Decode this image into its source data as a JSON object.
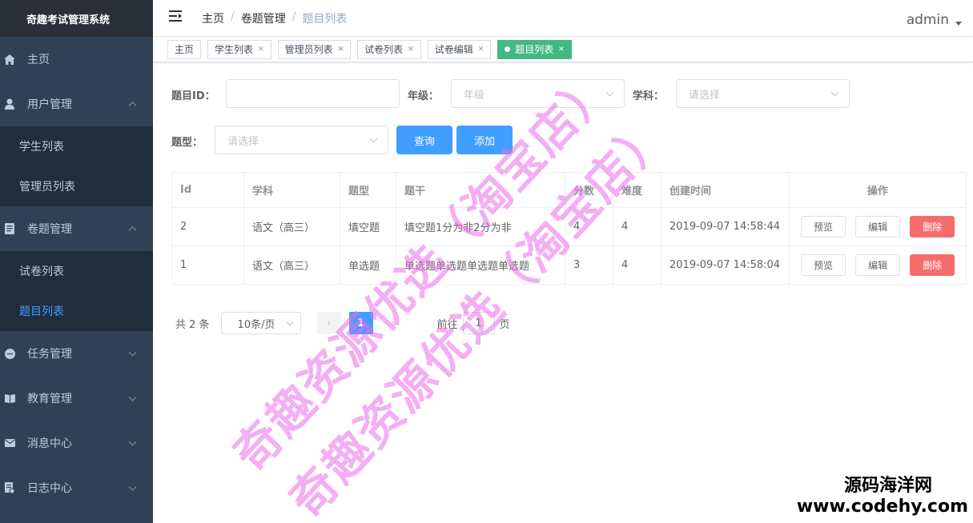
{
  "sidebar": {
    "logo": "奇趣考试管理系统",
    "items": [
      {
        "label": "主页",
        "icon": "home-icon"
      },
      {
        "label": "用户管理",
        "icon": "user-icon",
        "expanded": true,
        "children": [
          "学生列表",
          "管理员列表"
        ]
      },
      {
        "label": "卷题管理",
        "icon": "paper-icon",
        "expanded": true,
        "children": [
          "试卷列表",
          "题目列表"
        ]
      },
      {
        "label": "任务管理",
        "icon": "task-icon"
      },
      {
        "label": "教育管理",
        "icon": "book-icon"
      },
      {
        "label": "消息中心",
        "icon": "mail-icon"
      },
      {
        "label": "日志中心",
        "icon": "log-icon"
      }
    ],
    "active_child": "题目列表"
  },
  "header": {
    "breadcrumb": [
      "主页",
      "卷题管理",
      "题目列表"
    ],
    "user": "admin"
  },
  "tags": [
    {
      "label": "主页",
      "closable": false
    },
    {
      "label": "学生列表",
      "closable": true
    },
    {
      "label": "管理员列表",
      "closable": true
    },
    {
      "label": "试卷列表",
      "closable": true
    },
    {
      "label": "试卷编辑",
      "closable": true
    },
    {
      "label": "题目列表",
      "closable": true,
      "active": true
    }
  ],
  "filters": {
    "id_label": "题目ID：",
    "grade_label": "年级：",
    "grade_placeholder": "年级",
    "subject_label": "学科：",
    "subject_placeholder": "请选择",
    "type_label": "题型：",
    "type_placeholder": "请选择",
    "query_button": "查询",
    "add_button": "添加"
  },
  "table": {
    "columns": [
      "Id",
      "学科",
      "题型",
      "题干",
      "分数",
      "难度",
      "创建时间",
      "操作"
    ],
    "rows": [
      {
        "id": "2",
        "subject": "语文（高三）",
        "type": "填空题",
        "stem": "填空题1分为非2分为非",
        "score": "4",
        "difficulty": "4",
        "created": "2019-09-07 14:58:44"
      },
      {
        "id": "1",
        "subject": "语文（高三）",
        "type": "单选题",
        "stem": "单选题单选题单选题单选题",
        "score": "3",
        "difficulty": "4",
        "created": "2019-09-07 14:58:04"
      }
    ],
    "actions": {
      "preview": "预览",
      "edit": "编辑",
      "delete": "删除"
    }
  },
  "pagination": {
    "total": "共 2 条",
    "page_size": "10条/页",
    "current": "1",
    "goto_prefix": "前往",
    "goto_value": "1",
    "goto_suffix": "页"
  },
  "watermark": {
    "text1": "奇趣资源优选（淘宝店）",
    "text2": "奇趣资源优选（淘宝店）",
    "corner1": "源码海洋网",
    "corner2": "www.codehy.com"
  },
  "colors": {
    "sidebar_bg": "#304156",
    "submenu_bg": "#1f2d3d",
    "primary": "#409eff",
    "danger": "#f56c6c",
    "active_tag": "#42b983"
  }
}
